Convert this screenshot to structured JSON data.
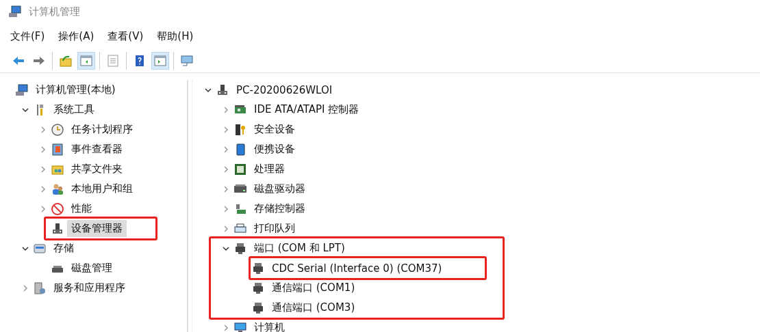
{
  "window": {
    "title": "计算机管理"
  },
  "menu": [
    "文件(F)",
    "操作(A)",
    "查看(V)",
    "帮助(H)"
  ],
  "toolbar": [
    [
      {
        "pressed": false
      },
      {
        "pressed": false
      }
    ],
    [
      {
        "pressed": false
      },
      {
        "pressed": true
      }
    ],
    [
      {
        "pressed": false
      }
    ],
    [
      {
        "pressed": false
      },
      {
        "pressed": true
      }
    ],
    [
      {
        "pressed": false
      }
    ]
  ],
  "console_tree": [
    {
      "label": "计算机管理(本地)",
      "selected": false,
      "children": [
        {
          "label": "系统工具",
          "expanded": true,
          "selected": false,
          "children": [
            {
              "label": "任务计划程序",
              "expanded": false,
              "selected": false
            },
            {
              "label": "事件查看器",
              "expanded": false,
              "selected": false
            },
            {
              "label": "共享文件夹",
              "expanded": false,
              "selected": false
            },
            {
              "label": "本地用户和组",
              "expanded": false,
              "selected": false
            },
            {
              "label": "性能",
              "expanded": false,
              "selected": false
            },
            {
              "label": "设备管理器",
              "selected": true,
              "highlighted": true
            }
          ]
        },
        {
          "label": "存储",
          "expanded": true,
          "selected": false,
          "children": [
            {
              "label": "磁盘管理",
              "selected": false
            }
          ]
        },
        {
          "label": "服务和应用程序",
          "expanded": false,
          "selected": false
        }
      ]
    }
  ],
  "device_tree": [
    {
      "label": "PC-20200626WLOI",
      "expanded": true,
      "selected": false,
      "children": [
        {
          "label": "IDE ATA/ATAPI 控制器",
          "expanded": false,
          "selected": false
        },
        {
          "label": "安全设备",
          "expanded": false,
          "selected": false
        },
        {
          "label": "便携设备",
          "expanded": false,
          "selected": false
        },
        {
          "label": "处理器",
          "expanded": false,
          "selected": false
        },
        {
          "label": "磁盘驱动器",
          "expanded": false,
          "selected": false
        },
        {
          "label": "存储控制器",
          "expanded": false,
          "selected": false
        },
        {
          "label": "打印队列",
          "expanded": false,
          "selected": false
        },
        {
          "label": "端口 (COM 和 LPT)",
          "expanded": true,
          "selected": false,
          "highlighted": true,
          "children": [
            {
              "label": "CDC Serial (Interface 0) (COM37)",
              "selected": false,
              "highlighted": true
            },
            {
              "label": "通信端口 (COM1)",
              "selected": false
            },
            {
              "label": "通信端口 (COM3)",
              "selected": false
            }
          ]
        },
        {
          "label": "计算机",
          "expanded": false,
          "selected": false
        }
      ]
    }
  ]
}
